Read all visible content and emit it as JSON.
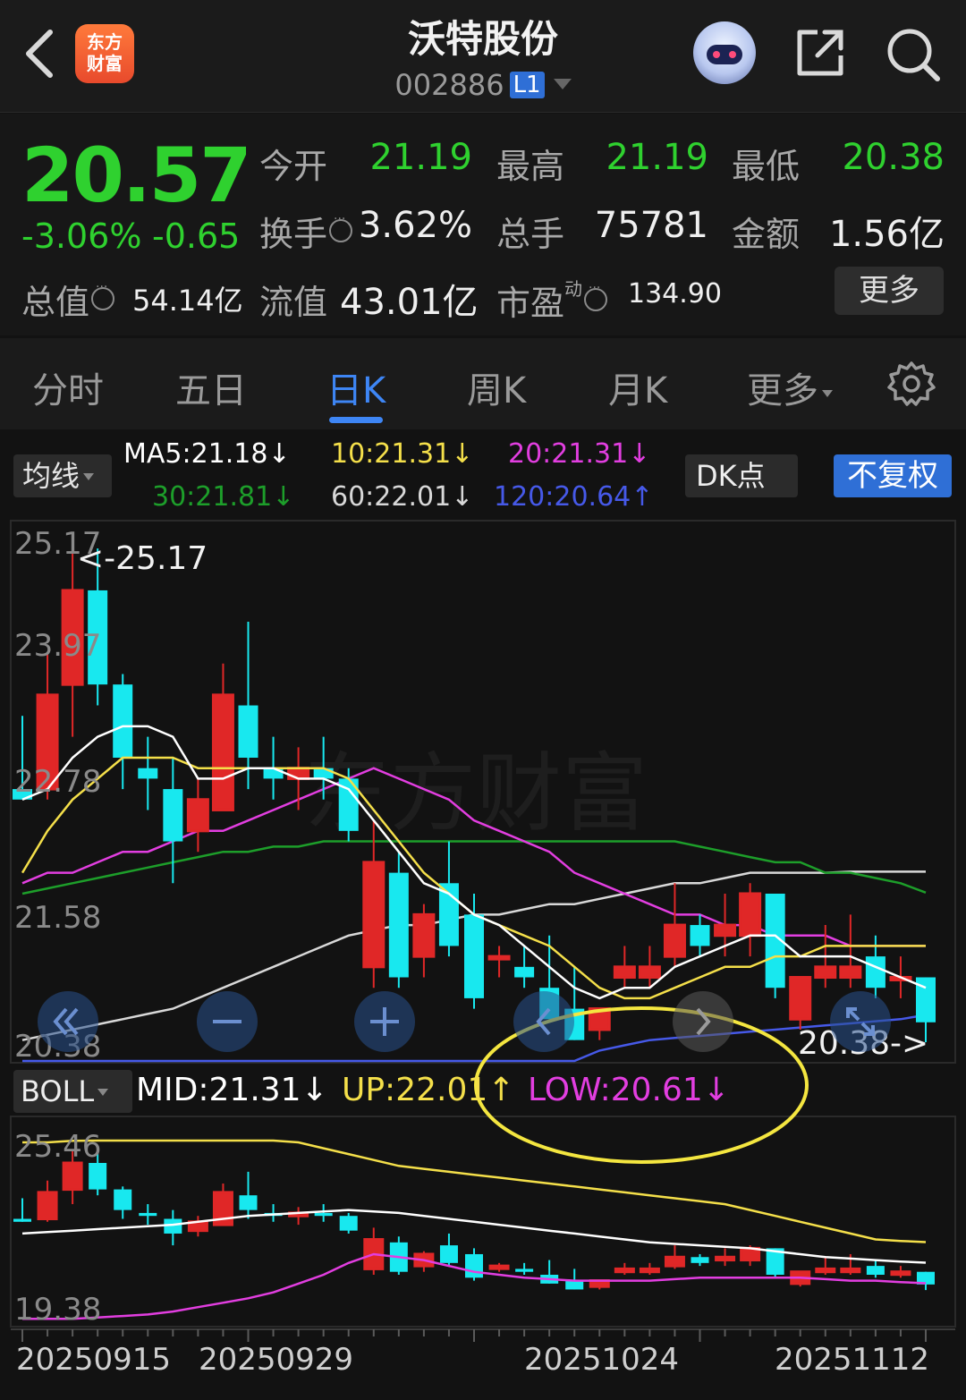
{
  "header": {
    "logo_line1": "东方",
    "logo_line2": "财富",
    "title": "沃特股份",
    "code": "002886",
    "level": "L1"
  },
  "quote": {
    "price": "20.57",
    "change_pct": "-3.06%",
    "change": "-0.65",
    "open_label": "今开",
    "open": "21.19",
    "high_label": "最高",
    "high": "21.19",
    "low_label": "最低",
    "low": "20.38",
    "turnover_label": "换手",
    "turnover": "3.62%",
    "volume_label": "总手",
    "volume": "75781",
    "amount_label": "金额",
    "amount": "1.56亿",
    "mktcap_label": "总值",
    "mktcap": "54.14亿",
    "float_label": "流值",
    "float": "43.01亿",
    "pe_label": "市盈",
    "pe_sup": "动",
    "pe": "134.90",
    "more": "更多"
  },
  "tabs": [
    "分时",
    "五日",
    "日K",
    "周K",
    "月K",
    "更多"
  ],
  "active_tab": "日K",
  "indicators": {
    "ma_btn": "均线",
    "ma5": "MA5:21.18↓",
    "ma10": "10:21.31↓",
    "ma20": "20:21.31↓",
    "ma30": "30:21.81↓",
    "ma60": "60:22.01↓",
    "ma120": "120:20.64↑",
    "dk_btn": "DK点",
    "fq_btn": "不复权"
  },
  "boll": {
    "btn": "BOLL",
    "mid": "MID:21.31↓",
    "up": "UP:22.01↑",
    "low": "LOW:20.61↓"
  },
  "main_chart": {
    "y_labels": [
      "25.17",
      "23.97",
      "22.78",
      "21.58",
      "20.38"
    ],
    "max_marker": "<-25.17",
    "min_marker": "20.38->"
  },
  "sub_chart": {
    "y_labels": [
      "25.46",
      "19.38"
    ]
  },
  "x_labels": [
    "20250915",
    "20250929",
    "20251024",
    "20251112"
  ],
  "colors": {
    "up": "#e02727",
    "down": "#18e8ef",
    "ma5": "#ffffff",
    "ma10": "#f4df4a",
    "ma20": "#e23ee0",
    "ma30": "#1d9e2a",
    "ma60": "#d8d8d8",
    "ma120": "#4659e8",
    "price_green": "#2fd12f",
    "accent": "#3e86f5"
  },
  "chart_data": {
    "type": "candlestick",
    "candles": [
      {
        "o": 22.8,
        "h": 23.5,
        "l": 22.7,
        "c": 22.7
      },
      {
        "o": 22.8,
        "h": 24.1,
        "l": 22.7,
        "c": 23.7
      },
      {
        "o": 23.8,
        "h": 25.17,
        "l": 23.3,
        "c": 24.7
      },
      {
        "o": 24.7,
        "h": 25.1,
        "l": 23.6,
        "c": 23.8
      },
      {
        "o": 23.8,
        "h": 23.9,
        "l": 22.8,
        "c": 23.1
      },
      {
        "o": 23.0,
        "h": 23.3,
        "l": 22.6,
        "c": 22.9
      },
      {
        "o": 22.8,
        "h": 23.1,
        "l": 21.9,
        "c": 22.3
      },
      {
        "o": 22.4,
        "h": 22.9,
        "l": 22.2,
        "c": 22.7
      },
      {
        "o": 22.6,
        "h": 24.0,
        "l": 22.6,
        "c": 23.7
      },
      {
        "o": 23.6,
        "h": 24.4,
        "l": 22.8,
        "c": 23.1
      },
      {
        "o": 23.0,
        "h": 23.3,
        "l": 22.7,
        "c": 22.9
      },
      {
        "o": 22.9,
        "h": 23.2,
        "l": 22.6,
        "c": 23.0
      },
      {
        "o": 23.0,
        "h": 23.3,
        "l": 22.7,
        "c": 22.9
      },
      {
        "o": 22.9,
        "h": 23.0,
        "l": 22.3,
        "c": 22.4
      },
      {
        "o": 21.1,
        "h": 22.5,
        "l": 20.9,
        "c": 22.1
      },
      {
        "o": 22.0,
        "h": 22.2,
        "l": 20.9,
        "c": 21.0
      },
      {
        "o": 21.2,
        "h": 21.7,
        "l": 21.0,
        "c": 21.6
      },
      {
        "o": 21.9,
        "h": 22.3,
        "l": 21.2,
        "c": 21.3
      },
      {
        "o": 21.6,
        "h": 21.8,
        "l": 20.7,
        "c": 20.8
      },
      {
        "o": 21.2,
        "h": 21.3,
        "l": 21.0,
        "c": 21.2
      },
      {
        "o": 21.1,
        "h": 21.3,
        "l": 20.9,
        "c": 21.0
      },
      {
        "o": 20.9,
        "h": 21.4,
        "l": 20.6,
        "c": 20.6
      },
      {
        "o": 20.7,
        "h": 21.1,
        "l": 20.4,
        "c": 20.4
      },
      {
        "o": 20.5,
        "h": 20.7,
        "l": 20.4,
        "c": 20.7
      },
      {
        "o": 21.0,
        "h": 21.3,
        "l": 20.9,
        "c": 21.1
      },
      {
        "o": 21.0,
        "h": 21.3,
        "l": 20.9,
        "c": 21.1
      },
      {
        "o": 21.2,
        "h": 21.9,
        "l": 21.1,
        "c": 21.5
      },
      {
        "o": 21.5,
        "h": 21.6,
        "l": 21.2,
        "c": 21.3
      },
      {
        "o": 21.4,
        "h": 21.8,
        "l": 21.2,
        "c": 21.5
      },
      {
        "o": 21.4,
        "h": 21.9,
        "l": 21.2,
        "c": 21.8
      },
      {
        "o": 21.8,
        "h": 21.8,
        "l": 20.8,
        "c": 20.9
      },
      {
        "o": 20.6,
        "h": 21.0,
        "l": 20.5,
        "c": 21.0
      },
      {
        "o": 21.0,
        "h": 21.5,
        "l": 20.9,
        "c": 21.1
      },
      {
        "o": 21.0,
        "h": 21.6,
        "l": 20.9,
        "c": 21.1
      },
      {
        "o": 21.2,
        "h": 21.4,
        "l": 20.8,
        "c": 20.9
      },
      {
        "o": 21.0,
        "h": 21.2,
        "l": 20.8,
        "c": 21.0
      },
      {
        "o": 21.0,
        "h": 21.0,
        "l": 20.38,
        "c": 20.57
      }
    ],
    "ma5": [
      22.7,
      22.8,
      23.1,
      23.3,
      23.4,
      23.4,
      23.3,
      22.9,
      22.9,
      23.0,
      23.0,
      22.9,
      22.9,
      22.8,
      22.5,
      22.2,
      21.9,
      21.8,
      21.6,
      21.5,
      21.3,
      21.1,
      20.9,
      20.8,
      20.9,
      20.9,
      21.1,
      21.2,
      21.3,
      21.4,
      21.4,
      21.2,
      21.2,
      21.2,
      21.1,
      21.0,
      20.9
    ],
    "ma10": [
      22.0,
      22.4,
      22.7,
      22.9,
      23.1,
      23.1,
      23.1,
      23.0,
      23.0,
      23.0,
      23.0,
      23.0,
      23.0,
      22.9,
      22.6,
      22.3,
      22.0,
      21.8,
      21.6,
      21.5,
      21.4,
      21.3,
      21.1,
      20.9,
      20.8,
      20.8,
      20.9,
      21.0,
      21.1,
      21.1,
      21.2,
      21.2,
      21.3,
      21.3,
      21.3,
      21.3,
      21.3
    ],
    "ma20": [
      21.9,
      22.0,
      22.0,
      22.1,
      22.2,
      22.2,
      22.3,
      22.4,
      22.4,
      22.5,
      22.6,
      22.7,
      22.8,
      22.9,
      23.0,
      22.9,
      22.8,
      22.7,
      22.5,
      22.4,
      22.3,
      22.2,
      22.0,
      21.9,
      21.8,
      21.7,
      21.6,
      21.6,
      21.5,
      21.5,
      21.4,
      21.4,
      21.4,
      21.3,
      21.3,
      21.3,
      21.3
    ],
    "ma30": [
      21.8,
      21.85,
      21.9,
      21.95,
      22.0,
      22.05,
      22.1,
      22.15,
      22.2,
      22.2,
      22.25,
      22.25,
      22.3,
      22.3,
      22.3,
      22.3,
      22.3,
      22.3,
      22.3,
      22.3,
      22.3,
      22.3,
      22.3,
      22.3,
      22.3,
      22.3,
      22.3,
      22.25,
      22.2,
      22.15,
      22.1,
      22.1,
      22.0,
      22.0,
      21.95,
      21.9,
      21.81
    ],
    "ma60": [
      20.4,
      20.45,
      20.5,
      20.55,
      20.6,
      20.65,
      20.7,
      20.8,
      20.9,
      21.0,
      21.1,
      21.2,
      21.3,
      21.4,
      21.45,
      21.5,
      21.5,
      21.55,
      21.6,
      21.6,
      21.65,
      21.7,
      21.7,
      21.75,
      21.8,
      21.85,
      21.9,
      21.9,
      21.95,
      22.0,
      22.0,
      22.0,
      22.0,
      22.01,
      22.01,
      22.01,
      22.01
    ],
    "ma120": [
      20.2,
      20.2,
      20.2,
      20.2,
      20.2,
      20.2,
      20.2,
      20.2,
      20.2,
      20.2,
      20.2,
      20.2,
      20.2,
      20.2,
      20.2,
      20.2,
      20.2,
      20.2,
      20.2,
      20.2,
      20.2,
      20.2,
      20.2,
      20.3,
      20.35,
      20.4,
      20.42,
      20.44,
      20.46,
      20.48,
      20.5,
      20.52,
      20.54,
      20.56,
      20.58,
      20.6,
      20.64
    ],
    "boll_up": [
      25.4,
      25.4,
      25.45,
      25.46,
      25.46,
      25.46,
      25.46,
      25.46,
      25.46,
      25.46,
      25.46,
      25.4,
      25.2,
      25.0,
      24.8,
      24.6,
      24.5,
      24.4,
      24.3,
      24.2,
      24.1,
      24.0,
      23.9,
      23.8,
      23.7,
      23.6,
      23.5,
      23.4,
      23.3,
      23.1,
      22.9,
      22.7,
      22.5,
      22.3,
      22.1,
      22.05,
      22.01
    ],
    "boll_mid": [
      22.3,
      22.35,
      22.4,
      22.45,
      22.5,
      22.55,
      22.6,
      22.7,
      22.8,
      22.9,
      22.95,
      23.0,
      23.05,
      23.1,
      23.05,
      23.0,
      22.9,
      22.8,
      22.7,
      22.6,
      22.5,
      22.4,
      22.3,
      22.2,
      22.1,
      22.0,
      21.95,
      21.9,
      21.85,
      21.8,
      21.7,
      21.6,
      21.5,
      21.45,
      21.4,
      21.35,
      21.31
    ],
    "boll_low": [
      19.4,
      19.4,
      19.4,
      19.45,
      19.5,
      19.55,
      19.65,
      19.8,
      19.95,
      20.1,
      20.3,
      20.6,
      20.9,
      21.3,
      21.6,
      21.5,
      21.4,
      21.2,
      21.0,
      20.9,
      20.8,
      20.75,
      20.7,
      20.7,
      20.7,
      20.7,
      20.75,
      20.8,
      20.8,
      20.8,
      20.8,
      20.8,
      20.75,
      20.7,
      20.7,
      20.65,
      20.61
    ],
    "ylim_main": [
      20.38,
      25.17
    ],
    "ylim_sub": [
      19.38,
      25.46
    ]
  }
}
